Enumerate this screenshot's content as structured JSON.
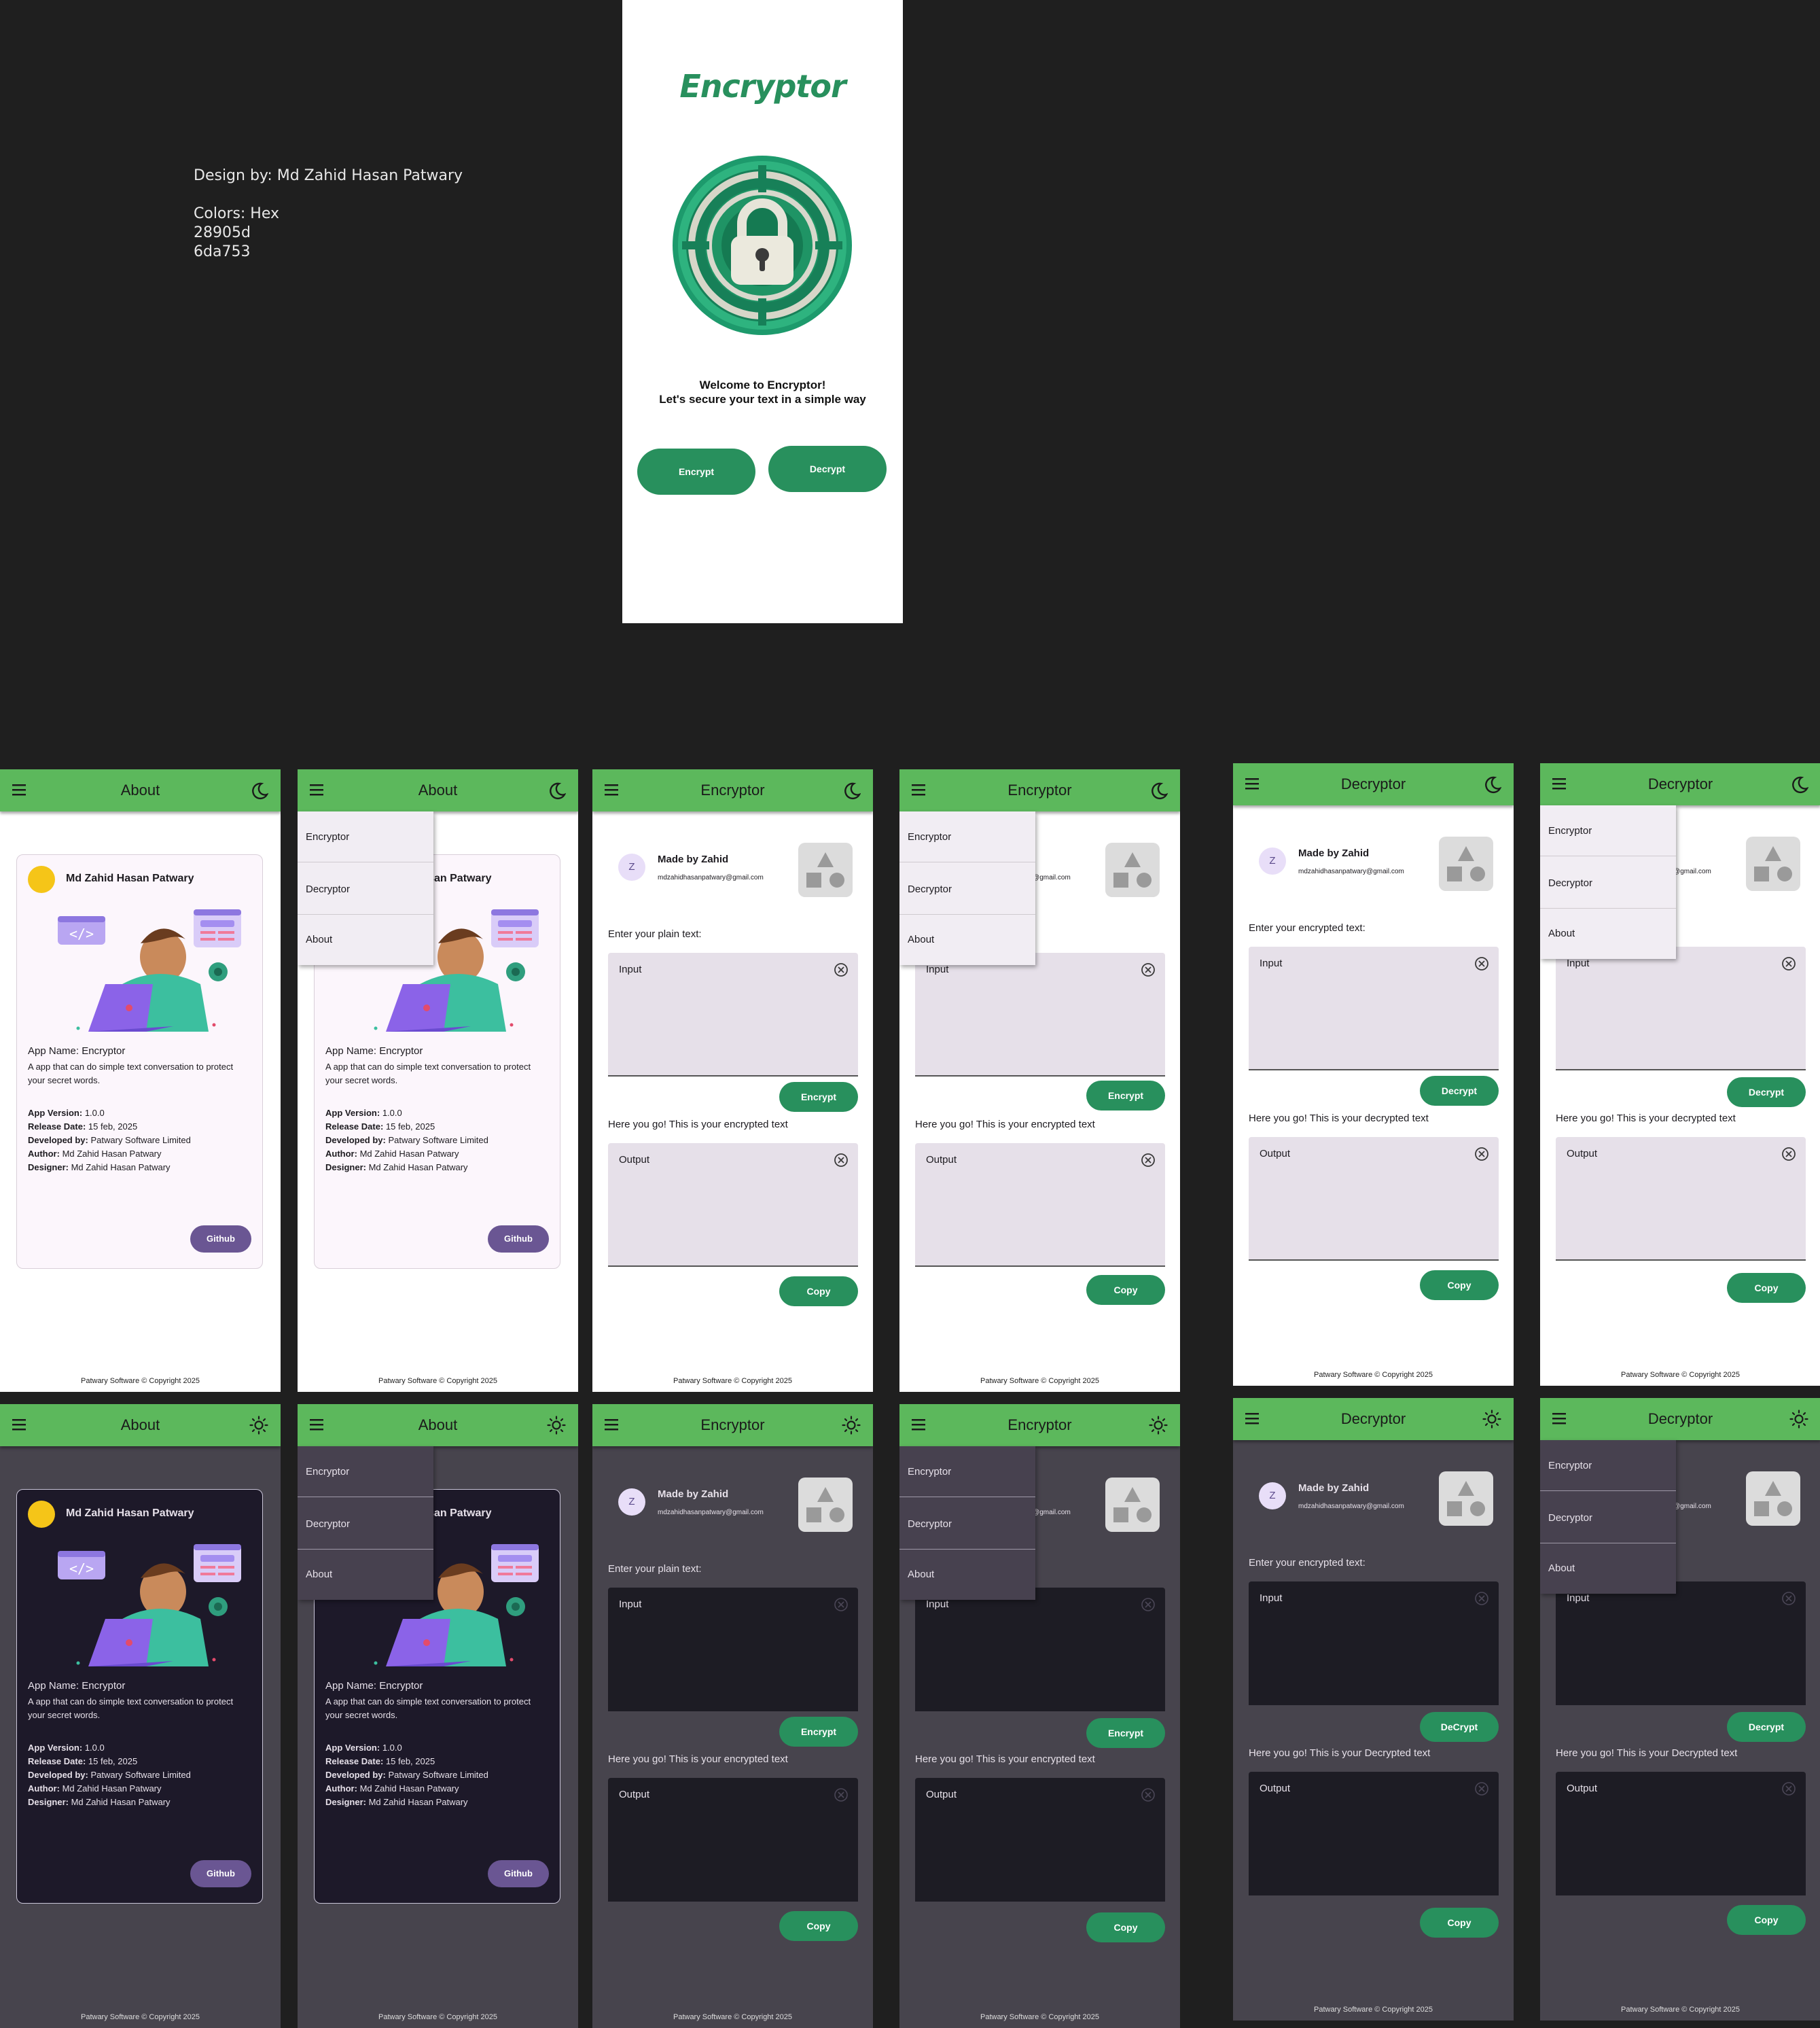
{
  "design_notes": {
    "designer": "Design by: Md Zahid Hasan Patwary",
    "colors_label": "Colors: Hex",
    "color1": "28905d",
    "color2": "6da753"
  },
  "colors": {
    "primary": "#28905d",
    "secondary": "#6da753",
    "appbar": "#5cb85c",
    "github": "#6a5693"
  },
  "splash": {
    "title": "Encryptor",
    "welcome_line1": "Welcome to Encryptor!",
    "welcome_line2": "Let's secure your text in a simple way",
    "encrypt_label": "Encrypt",
    "decrypt_label": "Decrypt"
  },
  "titles": {
    "about": "About",
    "encryptor": "Encryptor",
    "decryptor": "Decryptor"
  },
  "about": {
    "name": "Md Zahid Hasan Patwary",
    "app_name": "App Name: Encryptor",
    "description": "A app that can do simple text conversation to protect your secret words.",
    "version_label": "App Version:",
    "version": "1.0.0",
    "release_label": "Release Date:",
    "release": "15 feb, 2025",
    "developed_label": "Developed by:",
    "developed": "Patwary Software Limited",
    "author_label": "Author:",
    "author": "Md Zahid Hasan Patwary",
    "designer_label": "Designer:",
    "designer": "Md Zahid Hasan Patwary",
    "github_label": "Github"
  },
  "drawer": {
    "item1": "Encryptor",
    "item2": "Decryptor",
    "item3": "About"
  },
  "made_by": {
    "avatar_letter": "Z",
    "name": "Made by Zahid",
    "email": "mdzahidhasanpatwary@gmail.com"
  },
  "encryptor": {
    "input_prompt": "Enter your plain text:",
    "input_label": "Input",
    "encrypt_button": "Encrypt",
    "output_prompt": "Here you go! This is your encrypted text",
    "output_label": "Output",
    "copy_button": "Copy"
  },
  "decryptor": {
    "input_prompt": "Enter your encrypted text:",
    "input_label": "Input",
    "decrypt_button": "Decrypt",
    "decrypt_button_alt": "DeCrypt",
    "output_prompt": "Here you go! This is your decrypted text",
    "output_prompt_dark": "Here you go! This is your Decrypted text",
    "output_label": "Output",
    "copy_button": "Copy"
  },
  "footer": "Patwary Software © Copyright 2025",
  "icons": {
    "menu": "menu-icon",
    "dark_mode": "moon-icon",
    "light_mode": "sun-icon",
    "clear": "clear-icon",
    "shapes": "shapes-icon",
    "lock": "lock-icon"
  }
}
